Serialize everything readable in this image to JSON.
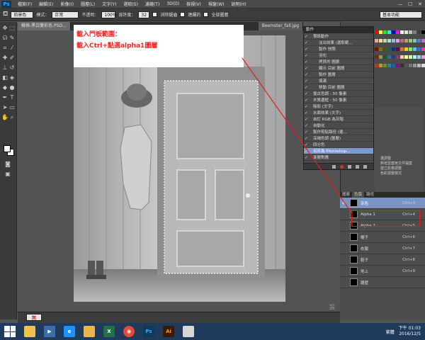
{
  "menubar": {
    "logo": "Ps",
    "items": [
      "檔案(F)",
      "編輯(E)",
      "影像(I)",
      "圖層(L)",
      "文字(Y)",
      "選取(S)",
      "濾鏡(T)",
      "3D(D)",
      "檢視(V)",
      "視窗(W)",
      "說明(H)"
    ],
    "window_controls": [
      "—",
      "☐",
      "✕"
    ]
  },
  "options": {
    "brush_preset": "前景色",
    "mode_label": "模式：",
    "mode_value": "正常",
    "opacity_label": "不透明：",
    "opacity_value": "100%",
    "tolerance_label": "容許度：",
    "tolerance_value": "32",
    "anti_alias": "消除鋸齒",
    "contiguous": "連續的",
    "all_layers": "全部圖層",
    "workspace": "基本功能"
  },
  "document": {
    "tab1": "蘇格-黑白雙彩色.PSD...",
    "tab2": "Beemster_fall.jpg",
    "zoom": "無",
    "watermark": "設計"
  },
  "note": {
    "line1": "載入門板範圍：",
    "line2": "載入Ctrl+點選alpha1圖層"
  },
  "actions": {
    "title": "動作",
    "rows": [
      {
        "label": "預設動作",
        "highlight": false
      },
      {
        "label": "淡出效果 (選取範...",
        "highlight": false
      },
      {
        "label": "製作 快照",
        "highlight": false
      },
      {
        "label": "羽化",
        "highlight": false
      },
      {
        "label": "拷貝的 圖層",
        "highlight": false
      },
      {
        "label": "顯示 目前 圖層",
        "highlight": false
      },
      {
        "label": "製作 圖層",
        "highlight": false
      },
      {
        "label": "填滿",
        "highlight": false
      },
      {
        "label": "移動 目前 圖層",
        "highlight": false
      },
      {
        "label": "復古色調 - 50 像素",
        "highlight": false
      },
      {
        "label": "木質邊框 - 50 像素",
        "highlight": false
      },
      {
        "label": "陰影 (文字)",
        "highlight": false
      },
      {
        "label": "水面效果 (文字)",
        "highlight": false
      },
      {
        "label": "自訂 RGB 為灰階",
        "highlight": false
      },
      {
        "label": "自動化",
        "highlight": false
      },
      {
        "label": "製作剪貼路徑 (選...",
        "highlight": false
      },
      {
        "label": "深褐色調 (圖層)",
        "highlight": false
      },
      {
        "label": "四分色",
        "highlight": false
      },
      {
        "label": "另存為 Photoshop...",
        "highlight": true
      },
      {
        "label": "漸層對應",
        "highlight": false
      }
    ]
  },
  "right_panel": {
    "adjust_text_1": "選調整",
    "adjust_text_2": "新增並套用文件檔案",
    "adjust_text_3": "建立影像調整",
    "adjust_text_4": "色彩調整樣式"
  },
  "channels": {
    "tabs": [
      "圖層",
      "色版",
      "路徑"
    ],
    "rows": [
      {
        "name": "灰色",
        "key": "Ctrl+3",
        "selected": true
      },
      {
        "name": "Alpha 1",
        "key": "Ctrl+4",
        "selected": false
      },
      {
        "name": "Alpha 2",
        "key": "Ctrl+5",
        "selected": false
      },
      {
        "name": "帽子",
        "key": "Ctrl+6",
        "selected": false
      },
      {
        "name": "衣服",
        "key": "Ctrl+7",
        "selected": false
      },
      {
        "name": "鞋子",
        "key": "Ctrl+8",
        "selected": false
      },
      {
        "name": "地上",
        "key": "Ctrl+9",
        "selected": false
      },
      {
        "name": "牆壁",
        "key": "",
        "selected": false
      }
    ]
  },
  "taskbar": {
    "lang": "繁體",
    "time": "下午 01:03",
    "date": "2016/12/5"
  }
}
